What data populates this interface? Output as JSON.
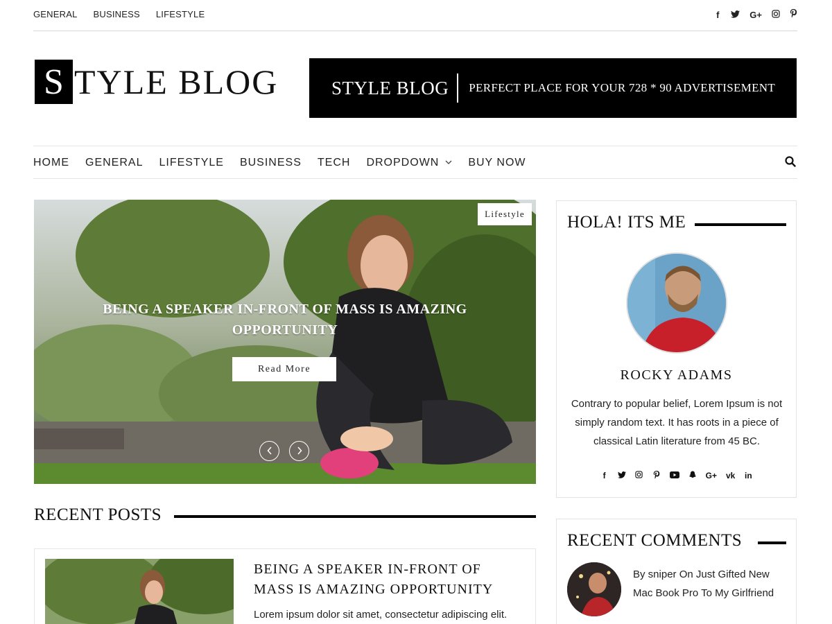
{
  "topbar": {
    "nav": [
      "GENERAL",
      "BUSINESS",
      "LIFESTYLE"
    ],
    "social": [
      {
        "icon": "facebook-icon",
        "glyph": "f"
      },
      {
        "icon": "twitter-icon",
        "glyph": "🐦"
      },
      {
        "icon": "google-plus-icon",
        "glyph": "G+"
      },
      {
        "icon": "instagram-icon",
        "glyph": "◎"
      },
      {
        "icon": "pinterest-icon",
        "glyph": "℘"
      }
    ]
  },
  "logo": {
    "initial": "S",
    "rest": "TYLE BLOG"
  },
  "ad": {
    "title": "STYLE BLOG",
    "text": "PERFECT PLACE FOR YOUR 728 * 90 ADVERTISEMENT"
  },
  "menu": [
    "HOME",
    "GENERAL",
    "LIFESTYLE",
    "BUSINESS",
    "TECH",
    "DROPDOWN",
    "BUY NOW"
  ],
  "hero": {
    "badge": "Lifestyle",
    "title": "BEING A SPEAKER IN-FRONT OF MASS IS AMAZING OPPORTUNITY",
    "read_more": "Read More"
  },
  "recent_posts": {
    "heading": "RECENT POSTS",
    "post": {
      "title": "BEING A SPEAKER IN-FRONT OF MASS IS AMAZING OPPORTUNITY",
      "excerpt": "Lorem ipsum dolor sit amet, consectetur adipiscing elit."
    }
  },
  "about_widget": {
    "heading": "HOLA! ITS ME",
    "name": "ROCKY ADAMS",
    "bio": "Contrary to popular belief, Lorem Ipsum is not simply random text. It has roots in a piece of classical Latin literature from 45 BC.",
    "social": [
      {
        "icon": "facebook-icon",
        "glyph": "f"
      },
      {
        "icon": "twitter-icon",
        "glyph": "🐦"
      },
      {
        "icon": "instagram-icon",
        "glyph": "◎"
      },
      {
        "icon": "pinterest-icon",
        "glyph": "℘"
      },
      {
        "icon": "youtube-icon",
        "glyph": "▶"
      },
      {
        "icon": "snapchat-icon",
        "glyph": "👻"
      },
      {
        "icon": "google-plus-icon",
        "glyph": "G+"
      },
      {
        "icon": "vk-icon",
        "glyph": "vk"
      },
      {
        "icon": "linkedin-icon",
        "glyph": "in"
      }
    ]
  },
  "comments_widget": {
    "heading": "RECENT COMMENTS",
    "comment": "By sniper On Just Gifted New Mac Book Pro To My Girlfriend"
  }
}
